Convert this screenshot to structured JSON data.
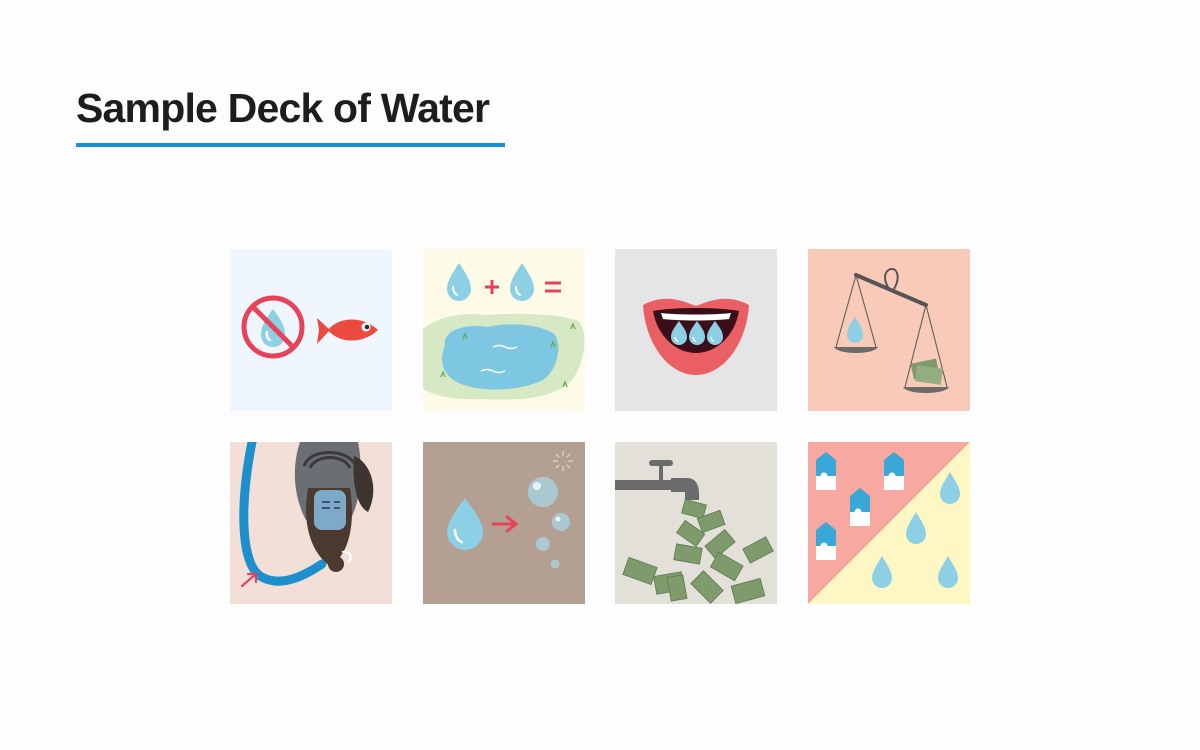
{
  "page": {
    "title": "Sample Deck of Water"
  },
  "colors": {
    "title_text": "#1d1d1f",
    "title_underline": "#1a8fd4",
    "water_drop": "#8dd0e6",
    "accent_red": "#e8425a",
    "money_green": "#7f9b6c"
  },
  "cards": [
    {
      "icon": "no-water-fish-icon",
      "background": "#eff6fd"
    },
    {
      "icon": "drops-plus-equals-pond-icon",
      "background": "#fdfbe7"
    },
    {
      "icon": "mouth-with-water-teeth-icon",
      "background": "#e6e5e5"
    },
    {
      "icon": "scale-water-vs-money-icon",
      "background": "#f8cab7"
    },
    {
      "icon": "person-drinking-from-hose-icon",
      "background": "#f2dfd7"
    },
    {
      "icon": "drop-to-bubbles-icon",
      "background": "#b4a093"
    },
    {
      "icon": "tap-pouring-money-icon",
      "background": "#e3e0d9"
    },
    {
      "icon": "milk-cartons-vs-water-drops-icon",
      "background": "#f7a8a1"
    }
  ]
}
